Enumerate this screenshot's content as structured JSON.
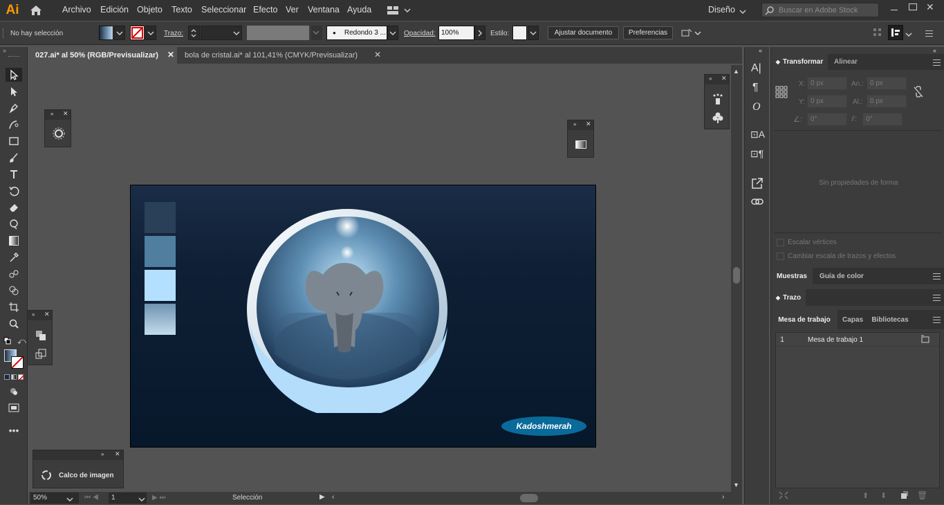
{
  "app": {
    "logo": "Ai",
    "workspace": "Diseño",
    "search_placeholder": "Buscar en Adobe Stock"
  },
  "menu": [
    "Archivo",
    "Edición",
    "Objeto",
    "Texto",
    "Seleccionar",
    "Efecto",
    "Ver",
    "Ventana",
    "Ayuda"
  ],
  "control": {
    "selection": "No hay selección",
    "stroke_label": "Trazo:",
    "brush": "Redondo 3 ...",
    "opacity_label": "Opacidad:",
    "opacity": "100%",
    "style_label": "Estilo:",
    "fit_button": "Ajustar documento",
    "prefs_button": "Preferencias"
  },
  "tabs": [
    {
      "label": "027.ai* al 50% (RGB/Previsualizar)"
    },
    {
      "label": "bola de cristal.ai* al 101,41% (CMYK/Previsualizar)"
    }
  ],
  "artwork": {
    "watermark": "Kadoshmerah",
    "swatches": [
      "#2a4058",
      "#4f7e9f",
      "#b4e0ff",
      "#a9c7dc"
    ]
  },
  "float_trace": {
    "label": "Calco de imagen"
  },
  "transform": {
    "tab1": "Transformar",
    "tab2": "Alinear",
    "x_label": "X:",
    "y_label": "Y:",
    "w_label": "An.:",
    "h_label": "Al.:",
    "x": "0 px",
    "y": "0 px",
    "w": "0 px",
    "h": "0 px",
    "angle": "0°",
    "shear": "0°",
    "empty": "Sin propiedades de forma",
    "chk1": "Escalar vértices",
    "chk2": "Cambiar escala de trazos y efectos"
  },
  "panels": {
    "muestras": "Muestras",
    "guia": "Guía de color",
    "trazo": "Trazo",
    "mesa": "Mesa de trabajo",
    "capas": "Capas",
    "bibliotecas": "Bibliotecas"
  },
  "artboards": [
    {
      "num": "1",
      "name": "Mesa de trabajo 1"
    }
  ],
  "status": {
    "zoom": "50%",
    "page": "1",
    "tool": "Selección"
  }
}
